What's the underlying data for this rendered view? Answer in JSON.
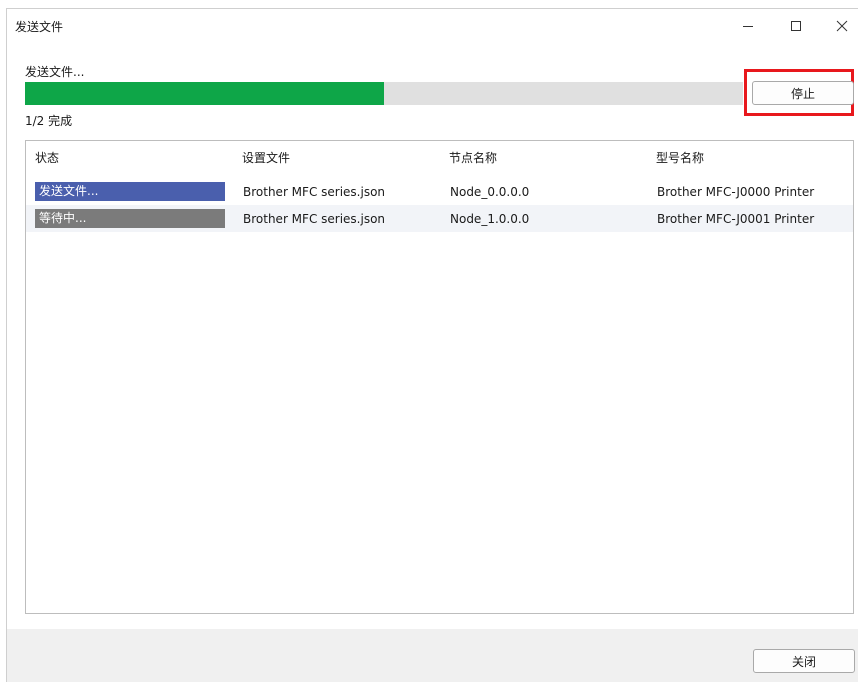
{
  "window": {
    "title": "发送文件",
    "controls": {
      "minimize": "minimize-icon",
      "maximize": "maximize-icon",
      "close": "close-icon"
    }
  },
  "progress": {
    "status_text": "发送文件...",
    "fraction": 0.5,
    "summary": "1/2 完成",
    "fill_color": "#0ea648"
  },
  "buttons": {
    "stop_label": "停止",
    "close_label": "关闭",
    "highlight_color": "#e8181d"
  },
  "table": {
    "columns": [
      "状态",
      "设置文件",
      "节点名称",
      "型号名称"
    ],
    "rows": [
      {
        "status": "发送文件...",
        "status_color": "#4a5fad",
        "setting_file": "Brother MFC series.json",
        "node_name": "Node_0.0.0.0",
        "model_name": "Brother MFC-J0000 Printer"
      },
      {
        "status": "等待中...",
        "status_color": "#7b7b7b",
        "setting_file": "Brother MFC series.json",
        "node_name": "Node_1.0.0.0",
        "model_name": "Brother MFC-J0001 Printer"
      }
    ]
  }
}
